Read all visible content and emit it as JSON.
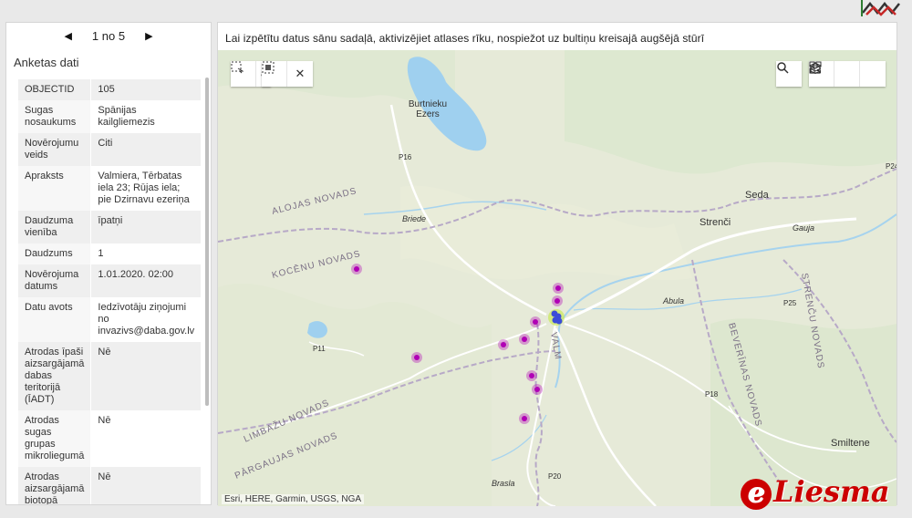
{
  "pager": {
    "prev_icon": "triangle-left-icon",
    "text": "1 no 5",
    "next_icon": "triangle-right-icon"
  },
  "panel": {
    "title": "Anketas dati",
    "rows": [
      {
        "key": "OBJECTID",
        "value": "105"
      },
      {
        "key": "Sugas nosaukums",
        "value": "Spānijas kailgliemezis"
      },
      {
        "key": "Novērojumu veids",
        "value": "Citi"
      },
      {
        "key": "Apraksts",
        "value": "Valmiera, Tērbatas iela 23; Rūjas iela; pie Dzirnavu ezeriņa"
      },
      {
        "key": "Daudzuma vienība",
        "value": "īpatņi"
      },
      {
        "key": "Daudzums",
        "value": "1"
      },
      {
        "key": "Novērojuma datums",
        "value": "1.01.2020. 02:00"
      },
      {
        "key": "Datu avots",
        "value": "Iedzīvotāju ziņojumi no invazivs@daba.gov.lv"
      },
      {
        "key": "Atrodas īpaši aizsargājamā dabas teritorijā (ĪADT)",
        "value": "Nē"
      },
      {
        "key": "Atrodas sugas grupas mikroliegumā",
        "value": "Nē"
      },
      {
        "key": "Atrodas aizsargājamā biotopā",
        "value": "Nē"
      }
    ]
  },
  "instruction": "Lai izpētītu datus sānu sadaļā, aktivizējiet atlases rīku, nospiežot uz bultiņu kreisajā augšējā stūrī",
  "toolbar": {
    "select_icon": "rectangle-select-icon",
    "select_partial": "a",
    "select_by_area_icon": "select-by-area-icon",
    "clear_icon": "close-icon",
    "search_icon": "search-icon",
    "home_icon": "home-icon",
    "layers_icon": "layers-icon",
    "qr_icon": "qr-code-icon"
  },
  "map": {
    "attribution": "Esri, HERE, Garmin, USGS, NGA",
    "lake_label_1": "Burtnieku",
    "lake_label_2": "Ezers",
    "places": [
      "Seda",
      "Strenči",
      "Smiltene"
    ],
    "rivers": [
      "Briede",
      "Gauja",
      "Abula",
      "Brasla"
    ],
    "roads": [
      "P16",
      "P11",
      "P25",
      "P18",
      "P20",
      "P24"
    ],
    "regions": [
      "ALOJAS NOVADS",
      "KOCĒNU NOVADS",
      "LIMBAŽU NOVADS",
      "PĀRGAUJAS NOVADS",
      "BEVERĪNAS NOVADS",
      "STRENČU NOVADS",
      "VALM"
    ],
    "marker_color": "#b000b5",
    "cluster_color": "#3b4cd8"
  },
  "watermark": {
    "e_letter": "e",
    "text": "Liesma"
  }
}
